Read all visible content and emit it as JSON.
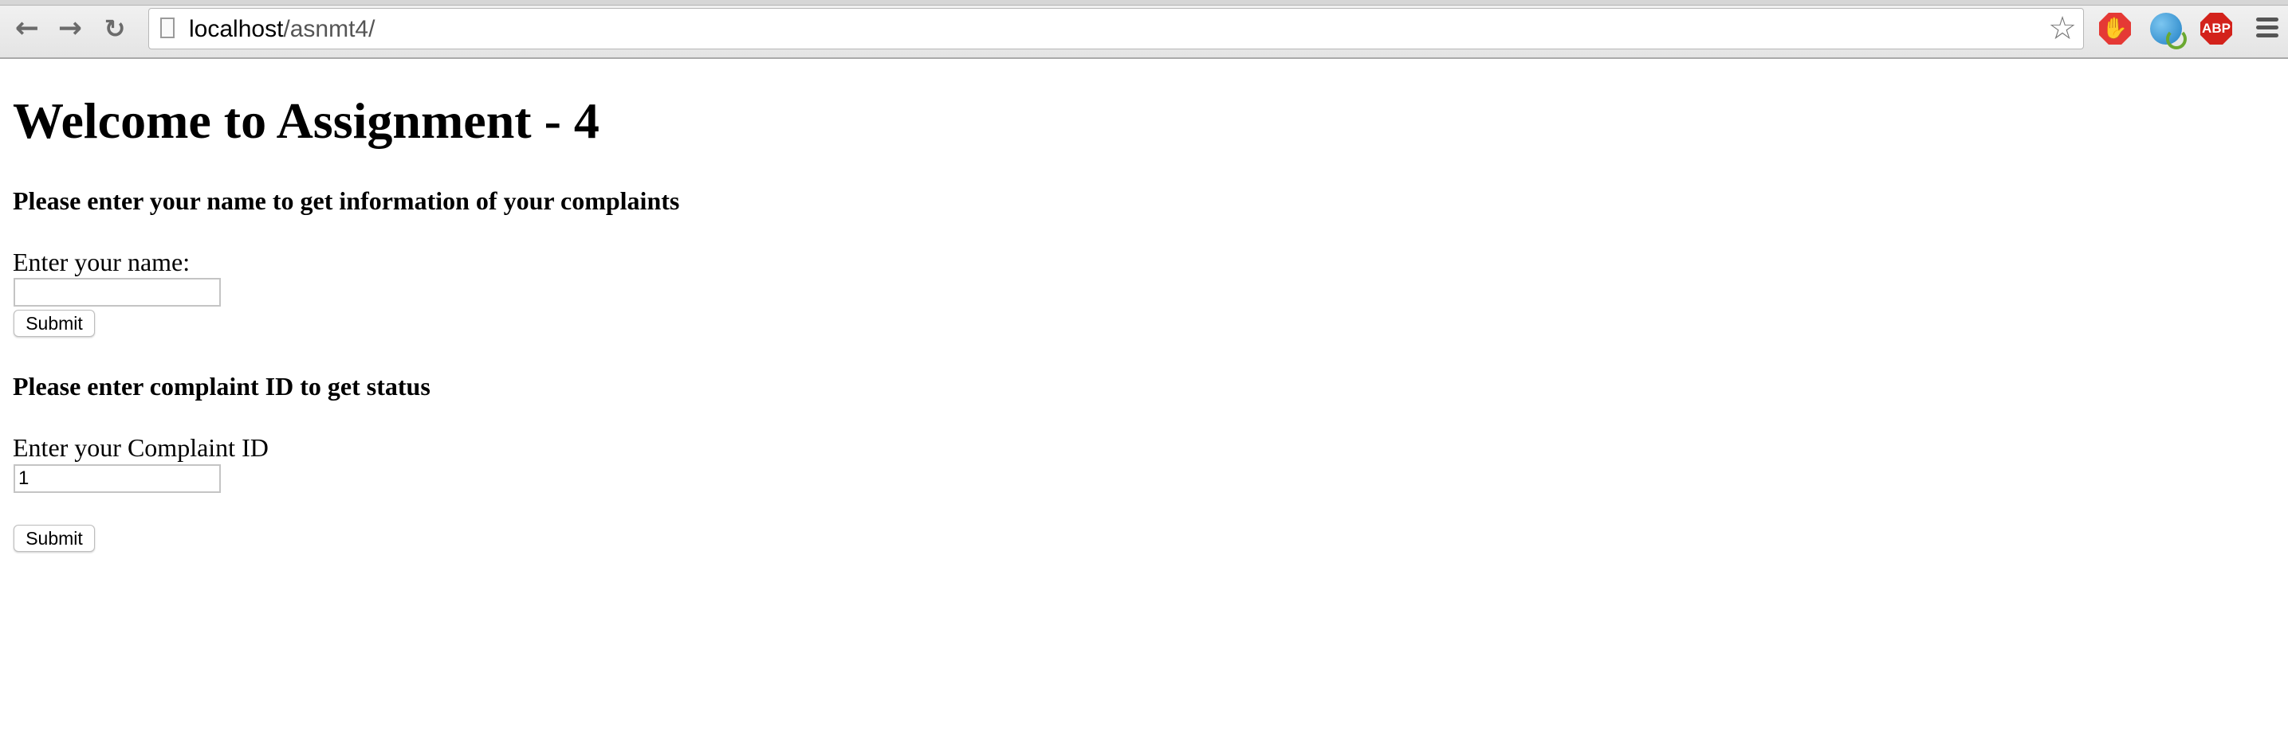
{
  "browser": {
    "url_host": "localhost",
    "url_path": "/asnmt4/",
    "icons": [
      "back-arrow-icon",
      "forward-arrow-icon",
      "reload-icon",
      "page-icon",
      "bookmark-star-icon",
      "stop-hand-extension-icon",
      "globe-extension-icon",
      "adblock-plus-extension-icon",
      "menu-icon"
    ],
    "abp_label": "ABP"
  },
  "page": {
    "title": "Welcome to Assignment - 4",
    "name_section": {
      "heading": "Please enter your name to get information of your complaints",
      "label": "Enter your name:",
      "value": "",
      "submit_label": "Submit"
    },
    "status_section": {
      "heading": "Please enter complaint ID to get status",
      "label": "Enter your Complaint ID",
      "value": "1",
      "submit_label": "Submit"
    }
  }
}
